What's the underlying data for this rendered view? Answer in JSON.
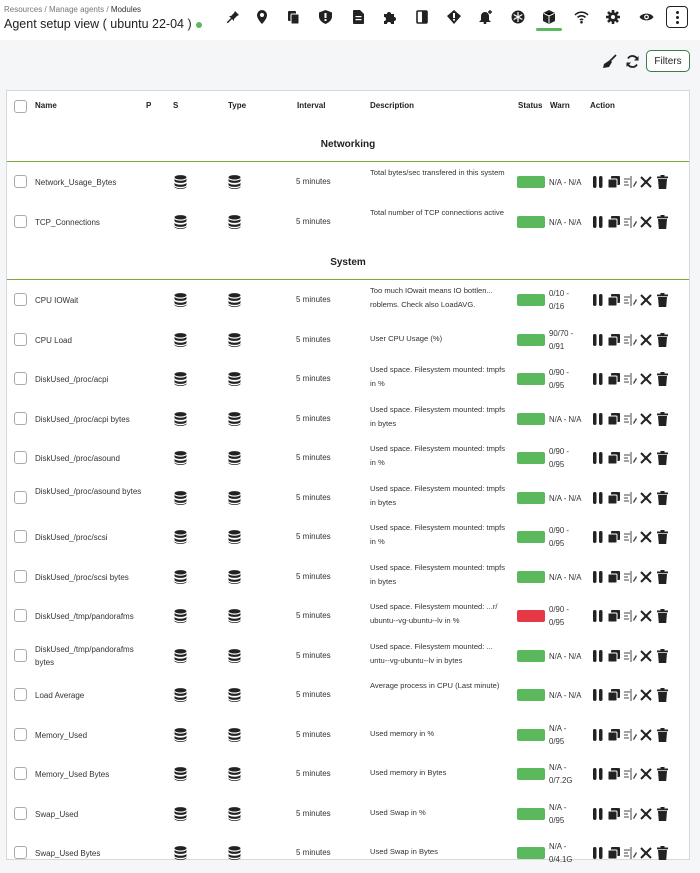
{
  "breadcrumb": {
    "part1": "Resources",
    "sep1": "/",
    "part2": "Manage agents",
    "sep2": "/",
    "current": "Modules"
  },
  "page_title": "Agent setup view ( ubuntu 22-04 )",
  "status_color": "#5cb85c",
  "nav_icons": [
    "pin-icon",
    "location-icon",
    "copy-icon",
    "shield-icon",
    "document-icon",
    "puzzle-icon",
    "panel-icon",
    "diamond-icon",
    "bell-plus-icon",
    "snowflake-icon",
    "cube-icon",
    "wifi-icon",
    "gear-icon",
    "eye-icon",
    "kebab-menu-icon"
  ],
  "tools": {
    "broom": "broom-icon",
    "refresh": "refresh-icon",
    "filters_label": "Filters"
  },
  "table": {
    "headers": {
      "name": "Name",
      "p": "P",
      "s": "S",
      "type": "Type",
      "interval": "Interval",
      "description": "Description",
      "status": "Status",
      "warn": "Warn",
      "action": "Action"
    },
    "sections": [
      {
        "title": "Networking",
        "rows": [
          {
            "name": "Network_Usage_Bytes",
            "interval": "5 minutes",
            "description": "Total bytes/sec transfered in this system",
            "status": "green",
            "warn": "N/A - N/A"
          },
          {
            "name": "TCP_Connections",
            "interval": "5 minutes",
            "description": "Total number of TCP connections active",
            "status": "green",
            "warn": "N/A - N/A"
          }
        ]
      },
      {
        "title": "System",
        "rows": [
          {
            "name": "CPU IOWait",
            "interval": "5 minutes",
            "description": "Too much IOwait means IO bottlen... roblems. Check also LoadAVG.",
            "status": "green",
            "warn": "0/10 - 0/16"
          },
          {
            "name": "CPU Load",
            "interval": "5 minutes",
            "description": "User CPU Usage (%)",
            "status": "green",
            "warn": "90/70 - 0/91"
          },
          {
            "name": "DiskUsed_/proc/acpi",
            "interval": "5 minutes",
            "description": "Used space. Filesystem mounted: tmpfs in %",
            "status": "green",
            "warn": "0/90 - 0/95"
          },
          {
            "name": "DiskUsed_/proc/acpi bytes",
            "interval": "5 minutes",
            "description": "Used space. Filesystem mounted: tmpfs in bytes",
            "status": "green",
            "warn": "N/A - N/A"
          },
          {
            "name": "DiskUsed_/proc/asound",
            "interval": "5 minutes",
            "description": "Used space. Filesystem mounted: tmpfs in %",
            "status": "green",
            "warn": "0/90 - 0/95"
          },
          {
            "name": "DiskUsed_/proc/asound bytes",
            "interval": "5 minutes",
            "description": "Used space. Filesystem mounted: tmpfs in bytes",
            "status": "green",
            "warn": "N/A - N/A"
          },
          {
            "name": "DiskUsed_/proc/scsi",
            "interval": "5 minutes",
            "description": "Used space. Filesystem mounted: tmpfs in %",
            "status": "green",
            "warn": "0/90 - 0/95"
          },
          {
            "name": "DiskUsed_/proc/scsi bytes",
            "interval": "5 minutes",
            "description": "Used space. Filesystem mounted: tmpfs in bytes",
            "status": "green",
            "warn": "N/A - N/A"
          },
          {
            "name": "DiskUsed_/tmp/pandorafms",
            "interval": "5 minutes",
            "description": "Used space. Filesystem mounted: ...r/ ubuntu--vg-ubuntu--lv in %",
            "status": "red",
            "warn": "0/90 - 0/95"
          },
          {
            "name": "DiskUsed_/tmp/pandorafms bytes",
            "interval": "5 minutes",
            "description": "Used space. Filesystem mounted: ... untu--vg-ubuntu--lv in bytes",
            "status": "green",
            "warn": "N/A - N/A"
          },
          {
            "name": "Load Average",
            "interval": "5 minutes",
            "description": "Average process in CPU (Last minute)",
            "status": "green",
            "warn": "N/A - N/A"
          },
          {
            "name": "Memory_Used",
            "interval": "5 minutes",
            "description": "Used memory in %",
            "status": "green",
            "warn": "N/A - 0/95"
          },
          {
            "name": "Memory_Used Bytes",
            "interval": "5 minutes",
            "description": "Used memory in Bytes",
            "status": "green",
            "warn": "N/A - 0/7.2G"
          },
          {
            "name": "Swap_Used",
            "interval": "5 minutes",
            "description": "Used Swap in %",
            "status": "green",
            "warn": "N/A - 0/95"
          },
          {
            "name": "Swap_Used Bytes",
            "interval": "5 minutes",
            "description": "Used Swap in Bytes",
            "status": "green",
            "warn": "N/A - 0/4.1G"
          }
        ]
      }
    ]
  },
  "colors": {
    "status_green": "#5cb85c",
    "status_red": "#e63946",
    "section_line": "#7aa63a",
    "accent": "#3e7a4e"
  }
}
